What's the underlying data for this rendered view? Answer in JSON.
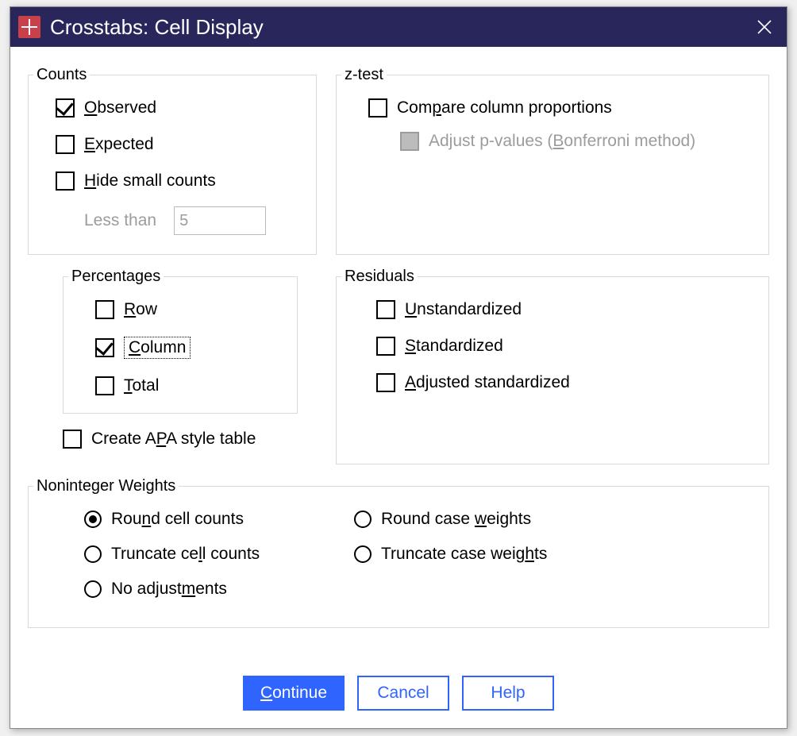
{
  "window": {
    "title": "Crosstabs: Cell Display"
  },
  "counts": {
    "legend": "Counts",
    "observed": "Observed",
    "expected": "Expected",
    "hide_small": "Hide small counts",
    "less_than_label": "Less than",
    "less_than_value": "5"
  },
  "ztest": {
    "legend": "z-test",
    "compare": "Compare column proportions",
    "adjust": "Adjust p-values (Bonferroni method)"
  },
  "percentages": {
    "legend": "Percentages",
    "row": "Row",
    "column": "Column",
    "total": "Total"
  },
  "apa_label": "Create APA style table",
  "residuals": {
    "legend": "Residuals",
    "unstandardized": "Unstandardized",
    "standardized": "Standardized",
    "adjusted": "Adjusted standardized"
  },
  "weights": {
    "legend": "Noninteger Weights",
    "round_cell": "Round cell counts",
    "round_case": "Round case weights",
    "trunc_cell": "Truncate cell counts",
    "trunc_case": "Truncate case weights",
    "no_adjust": "No adjustments"
  },
  "buttons": {
    "continue": "Continue",
    "cancel": "Cancel",
    "help": "Help"
  }
}
